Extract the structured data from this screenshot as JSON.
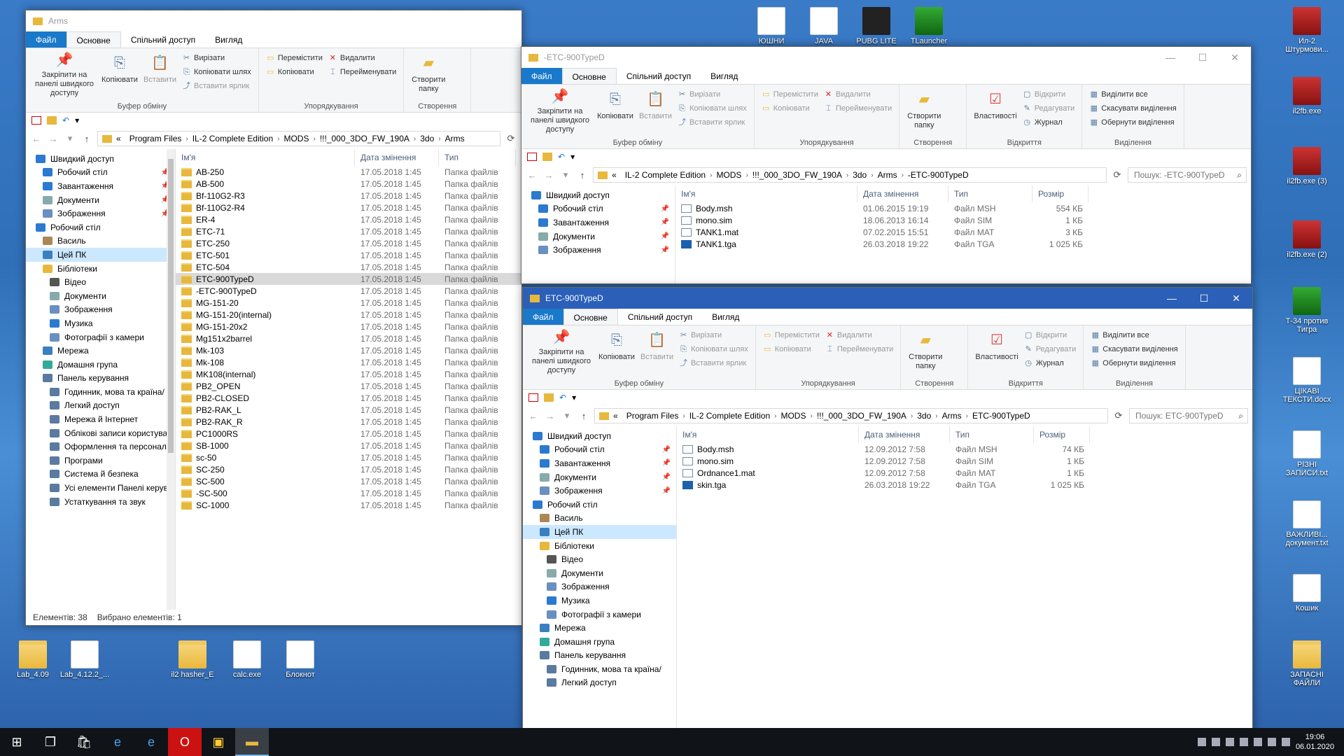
{
  "desktop_icons": [
    {
      "label": "Lab_4.09",
      "type": "folder"
    },
    {
      "label": "Lab_4.12.2_...",
      "type": "doc"
    },
    {
      "label": "il2 hasher_E",
      "type": "folder"
    },
    {
      "label": "calc.exe",
      "type": "doc"
    },
    {
      "label": "Блокнот",
      "type": "doc"
    },
    {
      "label": "Ил-2 Штурмови...",
      "type": "app"
    },
    {
      "label": "il2fb.exe",
      "type": "app"
    },
    {
      "label": "il2fb.exe (3)",
      "type": "app"
    },
    {
      "label": "il2fb.exe (2)",
      "type": "app"
    },
    {
      "label": "Т-34 против Тигра",
      "type": "green"
    },
    {
      "label": "ЦІКАВІ ТЕКСТИ.docx",
      "type": "doc"
    },
    {
      "label": "РІЗНІ ЗАПИСИ.txt",
      "type": "doc"
    },
    {
      "label": "ВАЖЛИВІ... документ.txt",
      "type": "doc"
    },
    {
      "label": "Кошик",
      "type": "doc"
    },
    {
      "label": "ЗАПАСНІ ФАЙЛИ",
      "type": "folder"
    },
    {
      "label": "PUBG LITE",
      "type": "dark"
    },
    {
      "label": "TLauncher",
      "type": "green"
    },
    {
      "label": "JAVA",
      "type": "doc"
    },
    {
      "label": "ЮШНИ",
      "type": "doc"
    }
  ],
  "ribbon": {
    "tabs": [
      "Файл",
      "Основне",
      "Спільний доступ",
      "Вигляд"
    ],
    "pin": "Закріпити на панелі швидкого доступу",
    "copy": "Копіювати",
    "paste": "Вставити",
    "cut": "Вирізати",
    "copy_path": "Копіювати шлях",
    "paste_shortcut": "Вставити ярлик",
    "clipboard": "Буфер обміну",
    "move_to": "Перемістити",
    "copy_to": "Копіювати",
    "delete": "Видалити",
    "rename": "Перейменувати",
    "organize": "Упорядкування",
    "new_folder": "Створити папку",
    "create": "Створення",
    "properties": "Властивості",
    "open": "Відкрити",
    "edit": "Редагувати",
    "history": "Журнал",
    "opening": "Відкриття",
    "select_all": "Виділити все",
    "select_none": "Скасувати виділення",
    "invert": "Обернути виділення",
    "selection": "Виділення"
  },
  "columns": {
    "name": "Ім'я",
    "date": "Дата змінення",
    "type": "Тип",
    "size": "Розмір"
  },
  "win1": {
    "title": "Arms",
    "path": [
      "Program Files",
      "IL-2 Complete Edition",
      "MODS",
      "!!!_000_3DO_FW_190A",
      "3do",
      "Arms"
    ],
    "nav": [
      {
        "label": "Швидкий доступ",
        "icon": "star",
        "indent": 0,
        "pin": false
      },
      {
        "label": "Робочий стіл",
        "icon": "desktop",
        "indent": 1,
        "pin": true
      },
      {
        "label": "Завантаження",
        "icon": "download",
        "indent": 1,
        "pin": true
      },
      {
        "label": "Документи",
        "icon": "doc",
        "indent": 1,
        "pin": true
      },
      {
        "label": "Зображення",
        "icon": "image",
        "indent": 1,
        "pin": true
      },
      {
        "label": "Робочий стіл",
        "icon": "desktop",
        "indent": 0,
        "pin": false
      },
      {
        "label": "Василь",
        "icon": "user",
        "indent": 1,
        "pin": false
      },
      {
        "label": "Цей ПК",
        "icon": "pc",
        "indent": 1,
        "pin": false,
        "selected": true
      },
      {
        "label": "Бібліотеки",
        "icon": "folder",
        "indent": 1,
        "pin": false
      },
      {
        "label": "Відео",
        "icon": "video",
        "indent": 2,
        "pin": false
      },
      {
        "label": "Документи",
        "icon": "doc",
        "indent": 2,
        "pin": false
      },
      {
        "label": "Зображення",
        "icon": "image",
        "indent": 2,
        "pin": false
      },
      {
        "label": "Музика",
        "icon": "music",
        "indent": 2,
        "pin": false
      },
      {
        "label": "Фотографії з камери",
        "icon": "image",
        "indent": 2,
        "pin": false
      },
      {
        "label": "Мережа",
        "icon": "net",
        "indent": 1,
        "pin": false
      },
      {
        "label": "Домашня група",
        "icon": "group",
        "indent": 1,
        "pin": false
      },
      {
        "label": "Панель керування",
        "icon": "cp",
        "indent": 1,
        "pin": false
      },
      {
        "label": "Годинник, мова та країна/",
        "icon": "cp",
        "indent": 2,
        "pin": false
      },
      {
        "label": "Легкий доступ",
        "icon": "cp",
        "indent": 2,
        "pin": false
      },
      {
        "label": "Мережа й Інтернет",
        "icon": "cp",
        "indent": 2,
        "pin": false
      },
      {
        "label": "Облікові записи користува",
        "icon": "cp",
        "indent": 2,
        "pin": false
      },
      {
        "label": "Оформлення та персонал",
        "icon": "cp",
        "indent": 2,
        "pin": false
      },
      {
        "label": "Програми",
        "icon": "cp",
        "indent": 2,
        "pin": false
      },
      {
        "label": "Система й безпека",
        "icon": "cp",
        "indent": 2,
        "pin": false
      },
      {
        "label": "Усі елементи Панелі керув",
        "icon": "cp",
        "indent": 2,
        "pin": false
      },
      {
        "label": "Устаткування та звук",
        "icon": "cp",
        "indent": 2,
        "pin": false
      }
    ],
    "files": [
      {
        "name": "AB-250",
        "date": "17.05.2018 1:45",
        "type": "Папка файлів"
      },
      {
        "name": "AB-500",
        "date": "17.05.2018 1:45",
        "type": "Папка файлів"
      },
      {
        "name": "Bf-110G2-R3",
        "date": "17.05.2018 1:45",
        "type": "Папка файлів"
      },
      {
        "name": "Bf-110G2-R4",
        "date": "17.05.2018 1:45",
        "type": "Папка файлів"
      },
      {
        "name": "ER-4",
        "date": "17.05.2018 1:45",
        "type": "Папка файлів"
      },
      {
        "name": "ETC-71",
        "date": "17.05.2018 1:45",
        "type": "Папка файлів"
      },
      {
        "name": "ETC-250",
        "date": "17.05.2018 1:45",
        "type": "Папка файлів"
      },
      {
        "name": "ETC-501",
        "date": "17.05.2018 1:45",
        "type": "Папка файлів"
      },
      {
        "name": "ETC-504",
        "date": "17.05.2018 1:45",
        "type": "Папка файлів"
      },
      {
        "name": "ETC-900TypeD",
        "date": "17.05.2018 1:45",
        "type": "Папка файлів",
        "selected": true
      },
      {
        "name": "-ETC-900TypeD",
        "date": "17.05.2018 1:45",
        "type": "Папка файлів"
      },
      {
        "name": "MG-151-20",
        "date": "17.05.2018 1:45",
        "type": "Папка файлів"
      },
      {
        "name": "MG-151-20(internal)",
        "date": "17.05.2018 1:45",
        "type": "Папка файлів"
      },
      {
        "name": "MG-151-20x2",
        "date": "17.05.2018 1:45",
        "type": "Папка файлів"
      },
      {
        "name": "Mg151x2barrel",
        "date": "17.05.2018 1:45",
        "type": "Папка файлів"
      },
      {
        "name": "Mk-103",
        "date": "17.05.2018 1:45",
        "type": "Папка файлів"
      },
      {
        "name": "Mk-108",
        "date": "17.05.2018 1:45",
        "type": "Папка файлів"
      },
      {
        "name": "MK108(internal)",
        "date": "17.05.2018 1:45",
        "type": "Папка файлів"
      },
      {
        "name": "PB2_OPEN",
        "date": "17.05.2018 1:45",
        "type": "Папка файлів"
      },
      {
        "name": "PB2-CLOSED",
        "date": "17.05.2018 1:45",
        "type": "Папка файлів"
      },
      {
        "name": "PB2-RAK_L",
        "date": "17.05.2018 1:45",
        "type": "Папка файлів"
      },
      {
        "name": "PB2-RAK_R",
        "date": "17.05.2018 1:45",
        "type": "Папка файлів"
      },
      {
        "name": "PC1000RS",
        "date": "17.05.2018 1:45",
        "type": "Папка файлів"
      },
      {
        "name": "SB-1000",
        "date": "17.05.2018 1:45",
        "type": "Папка файлів"
      },
      {
        "name": "sc-50",
        "date": "17.05.2018 1:45",
        "type": "Папка файлів"
      },
      {
        "name": "SC-250",
        "date": "17.05.2018 1:45",
        "type": "Папка файлів"
      },
      {
        "name": "SC-500",
        "date": "17.05.2018 1:45",
        "type": "Папка файлів"
      },
      {
        "name": "-SC-500",
        "date": "17.05.2018 1:45",
        "type": "Папка файлів"
      },
      {
        "name": "SC-1000",
        "date": "17.05.2018 1:45",
        "type": "Папка файлів"
      }
    ],
    "status_items": "Елементів: 38",
    "status_selected": "Вибрано елементів: 1"
  },
  "win2": {
    "title": "-ETC-900TypeD",
    "path": [
      "IL-2 Complete Edition",
      "MODS",
      "!!!_000_3DO_FW_190A",
      "3do",
      "Arms",
      "-ETC-900TypeD"
    ],
    "search": "Пошук: -ETC-900TypeD",
    "nav": [
      {
        "label": "Швидкий доступ",
        "icon": "star",
        "indent": 0,
        "pin": false
      },
      {
        "label": "Робочий стіл",
        "icon": "desktop",
        "indent": 1,
        "pin": true
      },
      {
        "label": "Завантаження",
        "icon": "download",
        "indent": 1,
        "pin": true
      },
      {
        "label": "Документи",
        "icon": "doc",
        "indent": 1,
        "pin": true
      },
      {
        "label": "Зображення",
        "icon": "image",
        "indent": 1,
        "pin": true
      }
    ],
    "files": [
      {
        "name": "Body.msh",
        "date": "01.06.2015 19:19",
        "type": "Файл MSH",
        "size": "554 КБ",
        "kind": "file"
      },
      {
        "name": "mono.sim",
        "date": "18.06.2013 16:14",
        "type": "Файл SIM",
        "size": "1 КБ",
        "kind": "file"
      },
      {
        "name": "TANK1.mat",
        "date": "07.02.2015 15:51",
        "type": "Файл MAT",
        "size": "3 КБ",
        "kind": "file"
      },
      {
        "name": "TANK1.tga",
        "date": "26.03.2018 19:22",
        "type": "Файл TGA",
        "size": "1 025 КБ",
        "kind": "tga"
      }
    ]
  },
  "win3": {
    "title": "ETC-900TypeD",
    "path": [
      "Program Files",
      "IL-2 Complete Edition",
      "MODS",
      "!!!_000_3DO_FW_190A",
      "3do",
      "Arms",
      "ETC-900TypeD"
    ],
    "search": "Пошук: ETC-900TypeD",
    "nav": [
      {
        "label": "Швидкий доступ",
        "icon": "star",
        "indent": 0,
        "pin": false
      },
      {
        "label": "Робочий стіл",
        "icon": "desktop",
        "indent": 1,
        "pin": true
      },
      {
        "label": "Завантаження",
        "icon": "download",
        "indent": 1,
        "pin": true
      },
      {
        "label": "Документи",
        "icon": "doc",
        "indent": 1,
        "pin": true
      },
      {
        "label": "Зображення",
        "icon": "image",
        "indent": 1,
        "pin": true
      },
      {
        "label": "Робочий стіл",
        "icon": "desktop",
        "indent": 0,
        "pin": false
      },
      {
        "label": "Василь",
        "icon": "user",
        "indent": 1,
        "pin": false
      },
      {
        "label": "Цей ПК",
        "icon": "pc",
        "indent": 1,
        "pin": false,
        "selected": true
      },
      {
        "label": "Бібліотеки",
        "icon": "folder",
        "indent": 1,
        "pin": false
      },
      {
        "label": "Відео",
        "icon": "video",
        "indent": 2,
        "pin": false
      },
      {
        "label": "Документи",
        "icon": "doc",
        "indent": 2,
        "pin": false
      },
      {
        "label": "Зображення",
        "icon": "image",
        "indent": 2,
        "pin": false
      },
      {
        "label": "Музика",
        "icon": "music",
        "indent": 2,
        "pin": false
      },
      {
        "label": "Фотографії з камери",
        "icon": "image",
        "indent": 2,
        "pin": false
      },
      {
        "label": "Мережа",
        "icon": "net",
        "indent": 1,
        "pin": false
      },
      {
        "label": "Домашня група",
        "icon": "group",
        "indent": 1,
        "pin": false
      },
      {
        "label": "Панель керування",
        "icon": "cp",
        "indent": 1,
        "pin": false
      },
      {
        "label": "Годинник, мова та країна/",
        "icon": "cp",
        "indent": 2,
        "pin": false
      },
      {
        "label": "Легкий доступ",
        "icon": "cp",
        "indent": 2,
        "pin": false
      }
    ],
    "files": [
      {
        "name": "Body.msh",
        "date": "12.09.2012 7:58",
        "type": "Файл MSH",
        "size": "74 КБ",
        "kind": "file"
      },
      {
        "name": "mono.sim",
        "date": "12.09.2012 7:58",
        "type": "Файл SIM",
        "size": "1 КБ",
        "kind": "file"
      },
      {
        "name": "Ordnance1.mat",
        "date": "12.09.2012 7:58",
        "type": "Файл MAT",
        "size": "1 КБ",
        "kind": "file"
      },
      {
        "name": "skin.tga",
        "date": "26.03.2018 19:22",
        "type": "Файл TGA",
        "size": "1 025 КБ",
        "kind": "tga"
      }
    ]
  },
  "taskbar": {
    "time": "19:06",
    "date": "06.01.2020"
  },
  "colors": {
    "accent": "#2b5fb8",
    "file_tab": "#1979ca",
    "selection": "#cce8ff",
    "folder": "#e8b83d"
  }
}
